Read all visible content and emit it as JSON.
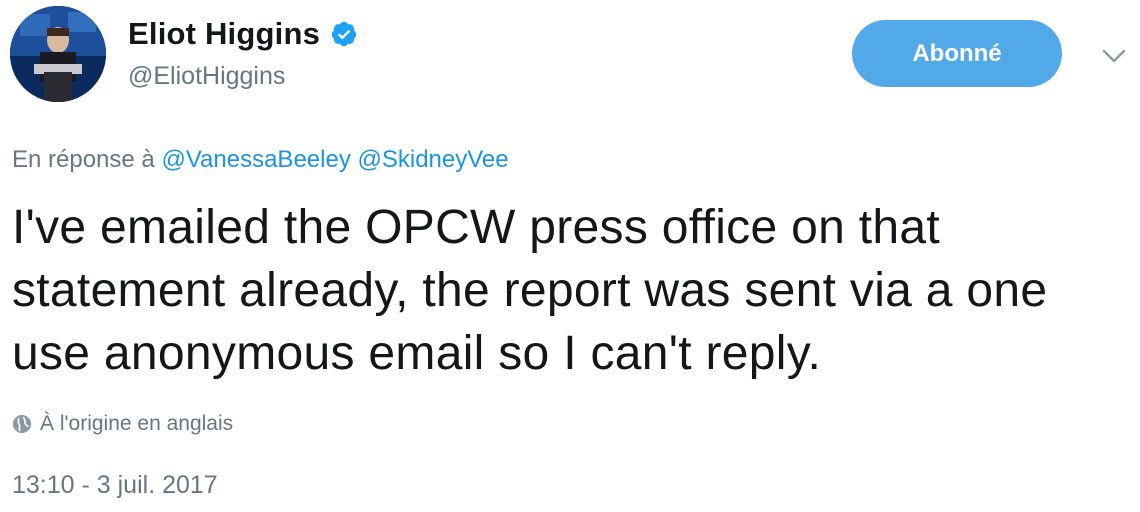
{
  "author": {
    "display_name": "Eliot Higgins",
    "handle": "@EliotHiggins",
    "verified": true,
    "avatar_icon": "avatar-photo"
  },
  "follow_button": {
    "label": "Abonné",
    "color": "#52a9ea"
  },
  "menu": {
    "icon": "chevron-down-icon"
  },
  "reply_context": {
    "prefix": "En réponse à",
    "mentions": [
      "@VanessaBeeley",
      "@SkidneyVee"
    ]
  },
  "tweet": {
    "text": "I've emailed the OPCW press office on that statement already, the report was sent via a one use anonymous email so I can't reply."
  },
  "translation": {
    "icon": "globe-icon",
    "label": "À l'origine en anglais"
  },
  "timestamp": "13:10 - 3 juil. 2017",
  "colors": {
    "link": "#1b95e0",
    "secondary_text": "#657786",
    "primary_text": "#14171a"
  }
}
